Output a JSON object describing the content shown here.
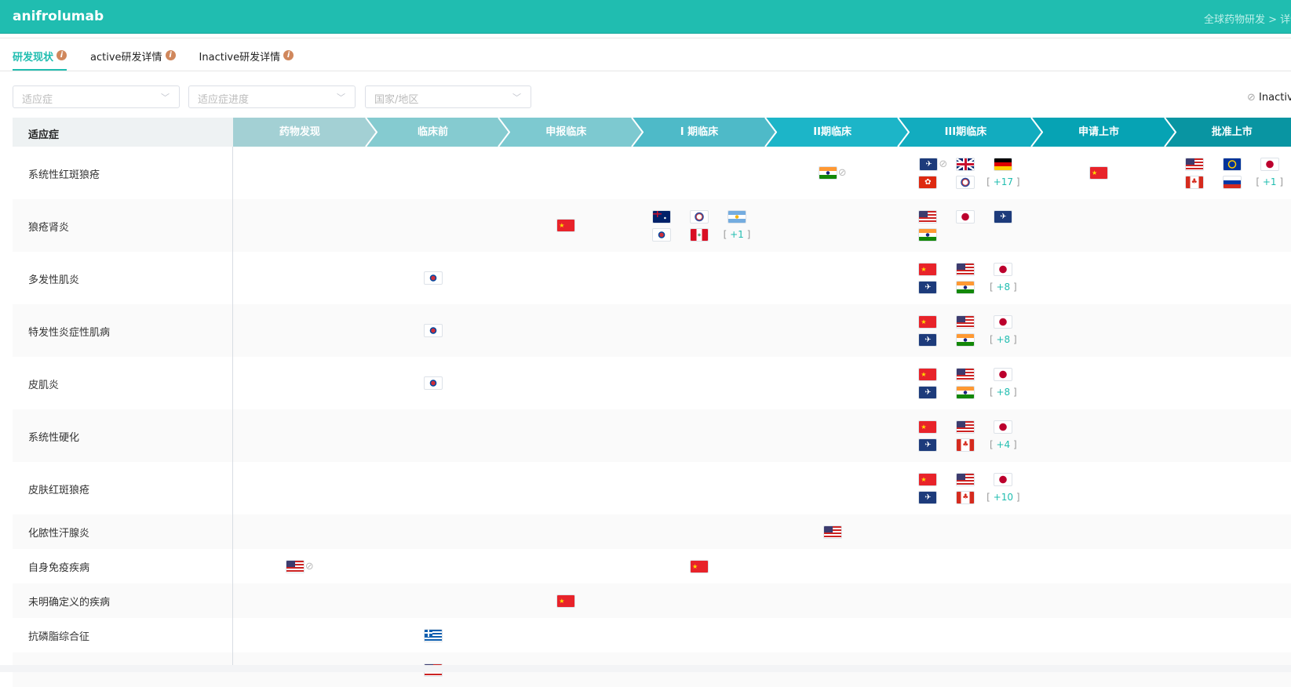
{
  "header": {
    "title": "anifrolumab",
    "breadcrumb": "全球药物研发 > 详情"
  },
  "tabs": [
    {
      "label": "研发现状",
      "active": true
    },
    {
      "label": "active研发详情",
      "active": false
    },
    {
      "label": "Inactive研发详情",
      "active": false
    }
  ],
  "info_icon": "i",
  "filters": [
    {
      "placeholder": "适应症"
    },
    {
      "placeholder": "适应症进度"
    },
    {
      "placeholder": "国家/地区"
    }
  ],
  "legend": {
    "icon": "⊘",
    "label": "Inactive"
  },
  "table": {
    "indication_header": "适应症",
    "stages": [
      {
        "label": "药物发现",
        "color": "#a3d0d4"
      },
      {
        "label": "临床前",
        "color": "#85cbd0"
      },
      {
        "label": "申报临床",
        "color": "#7dc9d0"
      },
      {
        "label": "I 期临床",
        "color": "#4ebac8"
      },
      {
        "label": "II期临床",
        "color": "#1cb5c8"
      },
      {
        "label": "III期临床",
        "color": "#12acbf"
      },
      {
        "label": "申请上市",
        "color": "#06a3b4"
      },
      {
        "label": "批准上市",
        "color": "#0995a2"
      }
    ],
    "rows": [
      {
        "name": "系统性红斑狼疮",
        "cells": {
          "4": {
            "flags": [
              {
                "c": "in",
                "inactive": true
              }
            ]
          },
          "5": {
            "flags": [
              {
                "c": "eumap",
                "inactive": true
              },
              {
                "c": "uk"
              },
              {
                "c": "de"
              },
              {
                "c": "hk"
              },
              {
                "c": "tw"
              }
            ],
            "more": "+17"
          },
          "6": {
            "flags": [
              {
                "c": "cn"
              }
            ]
          },
          "7": {
            "flags": [
              {
                "c": "us"
              },
              {
                "c": "eu"
              },
              {
                "c": "jp"
              },
              {
                "c": "ca"
              },
              {
                "c": "ru"
              }
            ],
            "more": "+1"
          }
        }
      },
      {
        "name": "狼疮肾炎",
        "cells": {
          "2": {
            "flags": [
              {
                "c": "cn"
              }
            ]
          },
          "3": {
            "flags": [
              {
                "c": "au"
              },
              {
                "c": "tw"
              },
              {
                "c": "ar"
              },
              {
                "c": "kr"
              },
              {
                "c": "pe"
              }
            ],
            "more": "+1"
          },
          "5": {
            "flags": [
              {
                "c": "us"
              },
              {
                "c": "jp"
              },
              {
                "c": "eumap"
              },
              {
                "c": "in"
              }
            ]
          }
        }
      },
      {
        "name": "多发性肌炎",
        "cells": {
          "1": {
            "flags": [
              {
                "c": "kr"
              }
            ]
          },
          "5": {
            "flags": [
              {
                "c": "cn"
              },
              {
                "c": "us"
              },
              {
                "c": "jp"
              },
              {
                "c": "eumap"
              },
              {
                "c": "in"
              }
            ],
            "more": "+8"
          }
        }
      },
      {
        "name": "特发性炎症性肌病",
        "cells": {
          "1": {
            "flags": [
              {
                "c": "kr"
              }
            ]
          },
          "5": {
            "flags": [
              {
                "c": "cn"
              },
              {
                "c": "us"
              },
              {
                "c": "jp"
              },
              {
                "c": "eumap"
              },
              {
                "c": "in"
              }
            ],
            "more": "+8"
          }
        }
      },
      {
        "name": "皮肌炎",
        "cells": {
          "1": {
            "flags": [
              {
                "c": "kr"
              }
            ]
          },
          "5": {
            "flags": [
              {
                "c": "cn"
              },
              {
                "c": "us"
              },
              {
                "c": "jp"
              },
              {
                "c": "eumap"
              },
              {
                "c": "in"
              }
            ],
            "more": "+8"
          }
        }
      },
      {
        "name": "系统性硬化",
        "cells": {
          "5": {
            "flags": [
              {
                "c": "cn"
              },
              {
                "c": "us"
              },
              {
                "c": "jp"
              },
              {
                "c": "eumap"
              },
              {
                "c": "ca"
              }
            ],
            "more": "+4"
          }
        }
      },
      {
        "name": "皮肤红斑狼疮",
        "cells": {
          "5": {
            "flags": [
              {
                "c": "cn"
              },
              {
                "c": "us"
              },
              {
                "c": "jp"
              },
              {
                "c": "eumap"
              },
              {
                "c": "ca"
              }
            ],
            "more": "+10"
          }
        }
      },
      {
        "name": "化脓性汗腺炎",
        "cells": {
          "4": {
            "flags": [
              {
                "c": "us"
              }
            ]
          }
        }
      },
      {
        "name": "自身免疫疾病",
        "cells": {
          "0": {
            "flags": [
              {
                "c": "us",
                "inactive": true
              }
            ]
          },
          "3": {
            "flags": [
              {
                "c": "cn"
              }
            ]
          }
        }
      },
      {
        "name": "未明确定义的疾病",
        "cells": {
          "2": {
            "flags": [
              {
                "c": "cn"
              }
            ]
          }
        }
      },
      {
        "name": "抗磷脂综合征",
        "cells": {
          "1": {
            "flags": [
              {
                "c": "gr"
              }
            ]
          }
        }
      },
      {
        "name": "",
        "cells": {
          "1": {
            "flags": [
              {
                "c": "us"
              }
            ]
          }
        }
      }
    ]
  }
}
